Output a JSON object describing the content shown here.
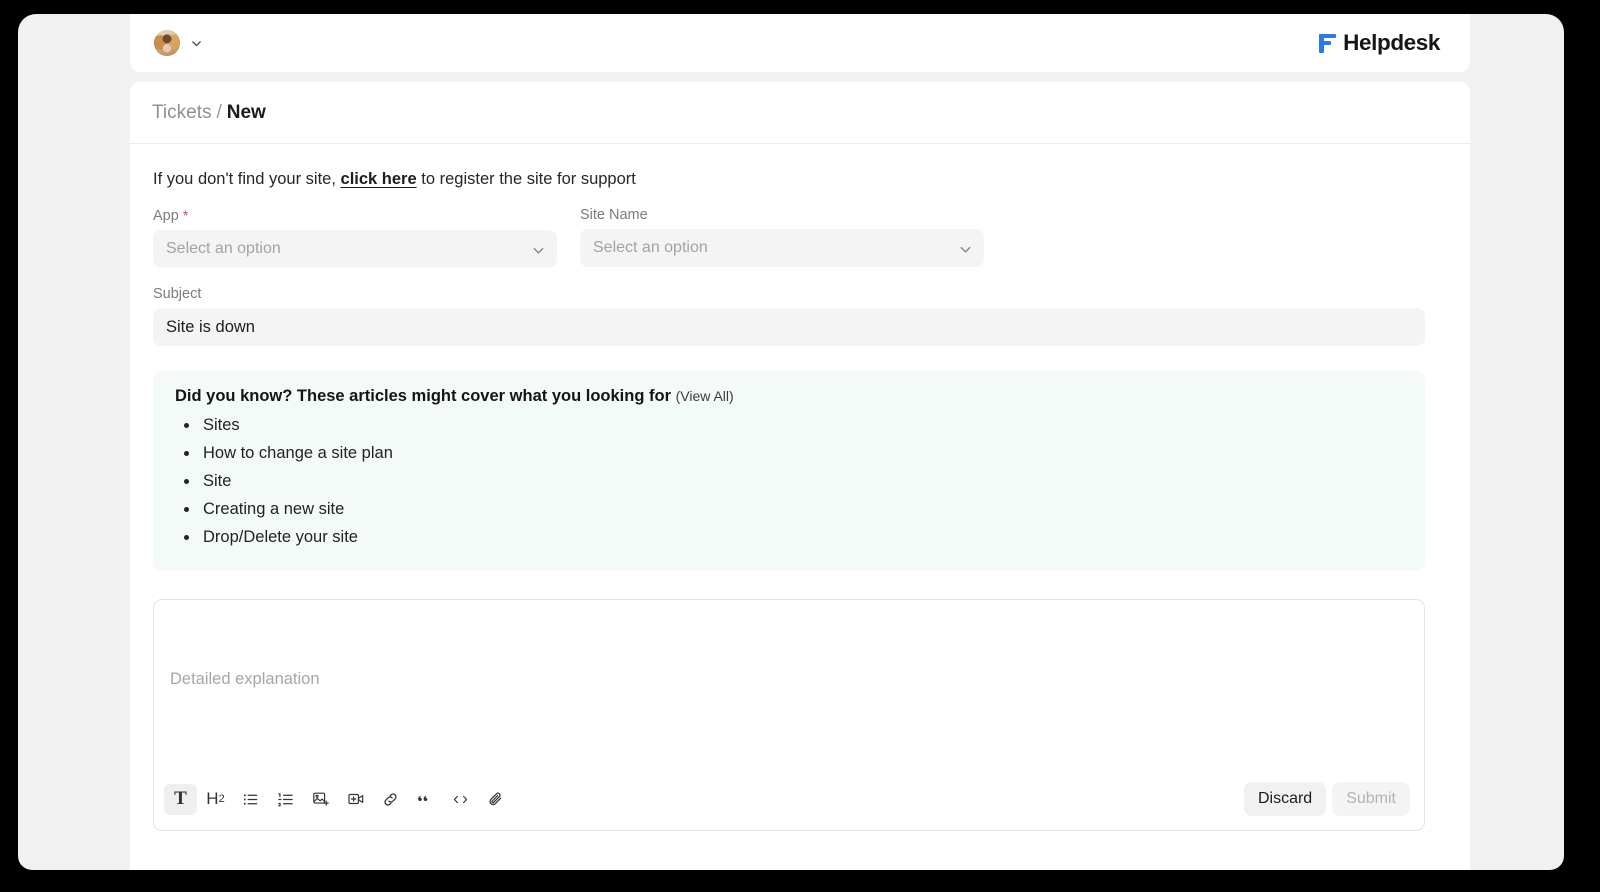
{
  "topbar": {
    "avatar_name": "user-avatar",
    "chevron": "chevron-down-icon",
    "brand_name": "Helpdesk"
  },
  "breadcrumb": {
    "parent": "Tickets",
    "separator": "/",
    "current": "New"
  },
  "form": {
    "notice_prefix": "If you don't find your site,",
    "notice_link": "click here",
    "notice_suffix": "to register the site for support",
    "app": {
      "label": "App",
      "required_mark": "*",
      "placeholder": "Select an option"
    },
    "site_name": {
      "label": "Site Name",
      "placeholder": "Select an option"
    },
    "subject": {
      "label": "Subject",
      "value": "Site is down"
    }
  },
  "articles": {
    "heading": "Did you know? These articles might cover what you looking for",
    "view_all": "(View All)",
    "items": [
      "Sites",
      "How to change a site plan",
      "Site",
      "Creating a new site",
      "Drop/Delete your site"
    ]
  },
  "editor": {
    "placeholder": "Detailed explanation",
    "toolbar": [
      {
        "name": "text-format-icon",
        "glyph": "T",
        "active": true
      },
      {
        "name": "heading-2-icon",
        "glyph": "H2",
        "active": false
      },
      {
        "name": "bullet-list-icon",
        "glyph": "",
        "active": false
      },
      {
        "name": "numbered-list-icon",
        "glyph": "",
        "active": false
      },
      {
        "name": "insert-image-icon",
        "glyph": "",
        "active": false
      },
      {
        "name": "insert-video-icon",
        "glyph": "",
        "active": false
      },
      {
        "name": "link-icon",
        "glyph": "",
        "active": false
      },
      {
        "name": "blockquote-icon",
        "glyph": "",
        "active": false
      },
      {
        "name": "code-block-icon",
        "glyph": "",
        "active": false
      },
      {
        "name": "attachment-icon",
        "glyph": "",
        "active": false
      }
    ],
    "discard_label": "Discard",
    "submit_label": "Submit"
  },
  "colors": {
    "brand_blue": "#2c7be5",
    "required_red": "#e4464b",
    "article_box_bg": "#f3faf7",
    "input_bg": "#f4f4f4",
    "page_bg": "#f1f1f1"
  }
}
